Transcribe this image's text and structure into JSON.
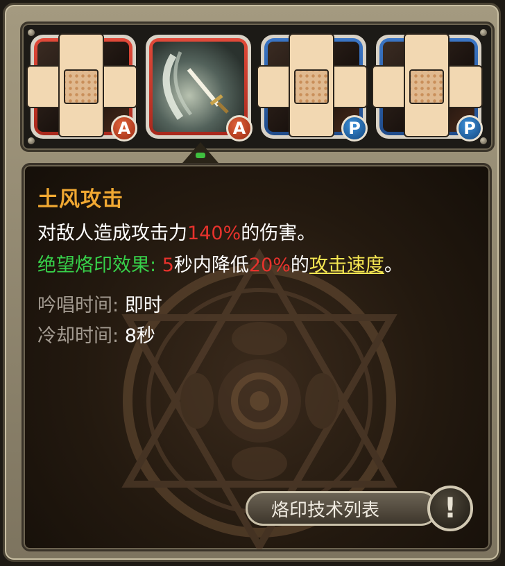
{
  "skills": [
    {
      "type_badge": "A",
      "kind": "active",
      "art": "covered",
      "covered": true
    },
    {
      "type_badge": "A",
      "kind": "active",
      "art": "sword",
      "covered": false
    },
    {
      "type_badge": "P",
      "kind": "passive",
      "art": "covered",
      "covered": true
    },
    {
      "type_badge": "P",
      "kind": "passive",
      "art": "covered",
      "covered": true
    }
  ],
  "detail": {
    "name": "土风攻击",
    "desc_prefix": "对敌人造成攻击力",
    "desc_value": "140%",
    "desc_suffix": "的伤害。",
    "seal_label": "绝望烙印效果",
    "seal_colon": ":",
    "seal_seconds": "5",
    "seal_mid": "秒内降低",
    "seal_percent": "20%",
    "seal_de": "的",
    "seal_link": "攻击速度",
    "seal_end": "。",
    "cast_label": "吟唱时间:",
    "cast_value": "即时",
    "cooldown_label": "冷却时间:",
    "cooldown_value": "8秒"
  },
  "buttons": {
    "seal_list": "烙印技术列表",
    "info_icon": "!"
  },
  "colors": {
    "title": "#f0a832",
    "highlight_red": "#e6322c",
    "seal_green": "#37d14a",
    "link_yellow": "#f5e652",
    "label_grey": "#a39b91"
  }
}
